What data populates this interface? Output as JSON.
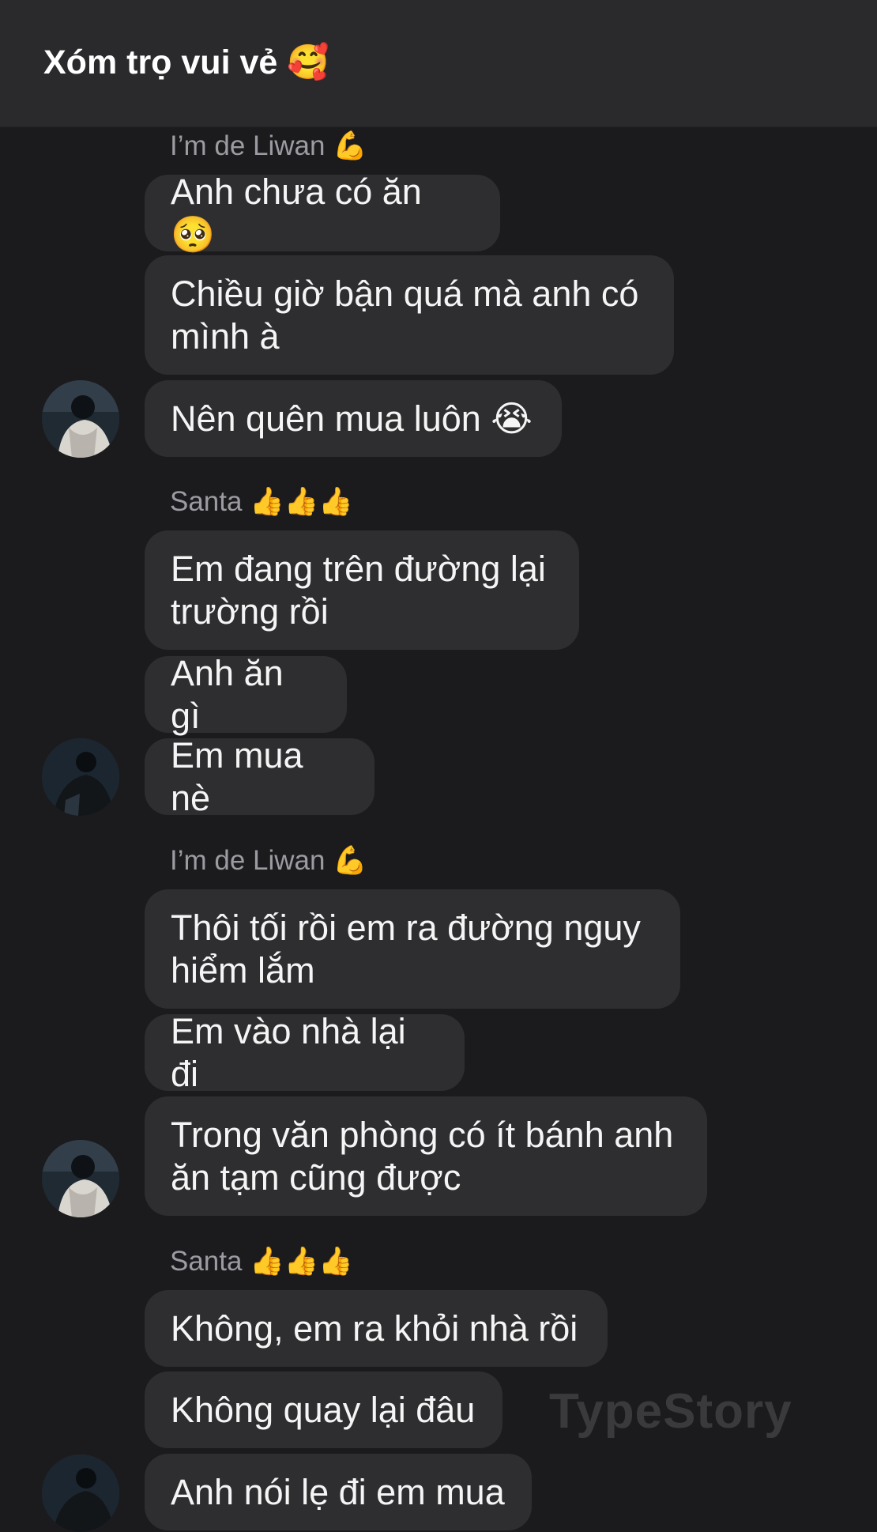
{
  "header": {
    "title": "Xóm trọ vui vẻ 🥰"
  },
  "messages": [
    {
      "sender": "I’m de Liwan 💪"
    },
    {
      "text": "Anh chưa có ăn 🥺"
    },
    {
      "text": "Chiều giờ bận quá mà anh có mình à"
    },
    {
      "text": "Nên quên mua luôn 😭"
    },
    {
      "sender": "Santa 👍👍👍"
    },
    {
      "text": "Em đang trên đường lại trường rồi"
    },
    {
      "text": "Anh ăn gì"
    },
    {
      "text": "Em mua nè"
    },
    {
      "sender": "I’m de Liwan 💪"
    },
    {
      "text": "Thôi tối rồi em ra đường nguy hiểm lắm"
    },
    {
      "text": "Em vào nhà lại đi"
    },
    {
      "text": "Trong văn phòng có ít bánh anh ăn tạm cũng được"
    },
    {
      "sender": "Santa 👍👍👍"
    },
    {
      "text": "Không, em ra khỏi nhà rồi"
    },
    {
      "text": "Không quay lại đâu"
    },
    {
      "text": "Anh nói lẹ đi em mua"
    }
  ],
  "watermark": "TypeStory",
  "colors": {
    "background": "#1b1b1d",
    "header": "#2a2a2c",
    "bubble": "#2e2e31",
    "sender_text": "#9b9ba1"
  }
}
